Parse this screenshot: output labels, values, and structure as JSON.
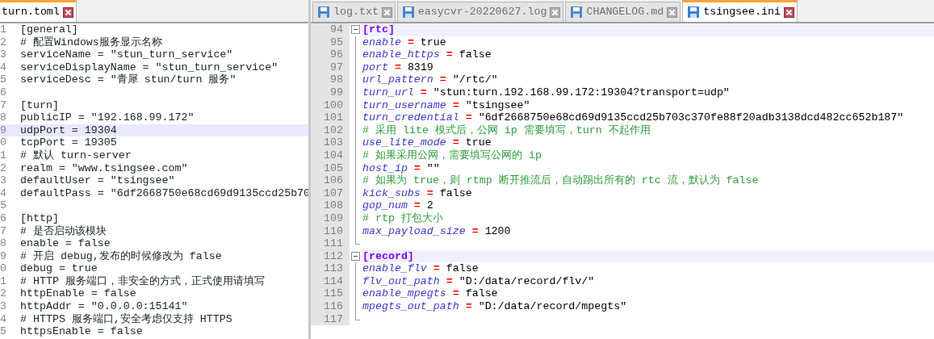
{
  "left_pane": {
    "tabs": [
      {
        "label": "turn.toml",
        "selected": true
      }
    ],
    "lines": [
      {
        "number": "1",
        "text": "[general]",
        "highlighted": false
      },
      {
        "number": "2",
        "text": "# 配置Windows服务显示名称",
        "highlighted": false
      },
      {
        "number": "3",
        "text": "serviceName = \"stun_turn_service\"",
        "highlighted": false
      },
      {
        "number": "4",
        "text": "serviceDisplayName = \"stun_turn_service\"",
        "highlighted": false
      },
      {
        "number": "5",
        "text": "serviceDesc = \"青犀 stun/turn 服务\"",
        "highlighted": false
      },
      {
        "number": "6",
        "highlighted": false
      },
      {
        "number": "7",
        "text": "[turn]",
        "highlighted": false
      },
      {
        "number": "8",
        "text": "publicIP = \"192.168.99.172\"",
        "highlighted": false
      },
      {
        "number": "9",
        "text": "udpPort = 19304",
        "highlighted": true
      },
      {
        "number": "0",
        "text": "tcpPort = 19305",
        "highlighted": false
      },
      {
        "number": "1",
        "text": "# 默认 turn-server",
        "highlighted": false
      },
      {
        "number": "2",
        "text": "realm = \"www.tsingsee.com\"",
        "highlighted": false
      },
      {
        "number": "3",
        "text": "defaultUser = \"tsingsee\"",
        "highlighted": false
      },
      {
        "number": "4",
        "text": "defaultPass = \"6df2668750e68cd69d9135ccd25b70",
        "highlighted": false
      },
      {
        "number": "5",
        "highlighted": false
      },
      {
        "number": "6",
        "text": "[http]",
        "highlighted": false
      },
      {
        "number": "7",
        "text": "# 是否启动该模块",
        "highlighted": false
      },
      {
        "number": "8",
        "text": "enable = false",
        "highlighted": false
      },
      {
        "number": "9",
        "text": "# 开启 debug,发布的时候修改为 false",
        "highlighted": false
      },
      {
        "number": "0",
        "text": "debug = true",
        "highlighted": false
      },
      {
        "number": "1",
        "text": "# HTTP 服务端口，非安全的方式，正式使用请填写",
        "highlighted": false
      },
      {
        "number": "2",
        "text": "httpEnable = false",
        "highlighted": false
      },
      {
        "number": "3",
        "text": "httpAddr = \"0.0.0.0:15141\"",
        "highlighted": false
      },
      {
        "number": "4",
        "text": "# HTTPS 服务端口,安全考虑仅支持 HTTPS",
        "highlighted": false
      },
      {
        "number": "5",
        "text": "httpsEnable = false",
        "highlighted": false
      }
    ]
  },
  "right_pane": {
    "tabs": [
      {
        "label": "log.txt",
        "selected": false
      },
      {
        "label": "easycvr-20220627.log",
        "selected": false
      },
      {
        "label": "CHANGELOG.md",
        "selected": false
      },
      {
        "label": "tsingsee.ini",
        "selected": true
      }
    ],
    "lines": [
      {
        "number": "94",
        "kind": "section",
        "text": "[rtc]",
        "fold_start": true,
        "fold_end": false,
        "highlighted": true
      },
      {
        "number": "95",
        "kind": "setting",
        "key": "enable",
        "op": "=",
        "value": "true",
        "fold_start": false,
        "fold_end": false,
        "highlighted": false
      },
      {
        "number": "96",
        "kind": "setting",
        "key": "enable_https",
        "op": "=",
        "value": "false",
        "fold_start": false,
        "fold_end": false,
        "highlighted": false
      },
      {
        "number": "97",
        "kind": "setting",
        "key": "port",
        "op": "=",
        "value": "8319",
        "fold_start": false,
        "fold_end": false,
        "highlighted": false
      },
      {
        "number": "98",
        "kind": "setting",
        "key": "url_pattern",
        "op": "=",
        "value": "\"/rtc/\"",
        "fold_start": false,
        "fold_end": false,
        "highlighted": false
      },
      {
        "number": "99",
        "kind": "setting",
        "key": "turn_url",
        "op": "=",
        "value": "\"stun:turn.192.168.99.172:19304?transport=udp\"",
        "fold_start": false,
        "fold_end": false,
        "highlighted": false
      },
      {
        "number": "100",
        "kind": "setting",
        "key": "turn_username",
        "op": "=",
        "value": "\"tsingsee\"",
        "fold_start": false,
        "fold_end": false,
        "highlighted": false
      },
      {
        "number": "101",
        "kind": "setting",
        "key": "turn_credential",
        "op": "=",
        "value": "\"6df2668750e68cd69d9135ccd25b703c370fe88f20adb3138dcd482cc652b187\"",
        "fold_start": false,
        "fold_end": false,
        "highlighted": false
      },
      {
        "number": "102",
        "kind": "comment",
        "text": "# 采用 lite 模式后，公网 ip 需要填写，turn 不起作用",
        "fold_start": false,
        "fold_end": false,
        "highlighted": false
      },
      {
        "number": "103",
        "kind": "setting",
        "key": "use_lite_mode",
        "op": "=",
        "value": "true",
        "fold_start": false,
        "fold_end": false,
        "highlighted": false
      },
      {
        "number": "104",
        "kind": "comment",
        "text": "# 如果采用公网，需要填写公网的 ip",
        "fold_start": false,
        "fold_end": false,
        "highlighted": false
      },
      {
        "number": "105",
        "kind": "setting",
        "key": "host_ip",
        "op": "=",
        "value": "\"\"",
        "fold_start": false,
        "fold_end": false,
        "highlighted": false
      },
      {
        "number": "106",
        "kind": "comment",
        "text": "# 如果为 true，则 rtmp 断开推流后，自动踢出所有的 rtc 流，默认为 false",
        "fold_start": false,
        "fold_end": false,
        "highlighted": false
      },
      {
        "number": "107",
        "kind": "setting",
        "key": "kick_subs",
        "op": "=",
        "value": "false",
        "fold_start": false,
        "fold_end": false,
        "highlighted": false
      },
      {
        "number": "108",
        "kind": "setting",
        "key": "gop_num",
        "op": "=",
        "value": "2",
        "fold_start": false,
        "fold_end": false,
        "highlighted": false
      },
      {
        "number": "109",
        "kind": "comment",
        "text": "# rtp 打包大小",
        "fold_start": false,
        "fold_end": false,
        "highlighted": false
      },
      {
        "number": "110",
        "kind": "setting",
        "key": "max_payload_size",
        "op": "=",
        "value": "1200",
        "fold_start": false,
        "fold_end": false,
        "highlighted": false
      },
      {
        "number": "111",
        "kind": "blank",
        "fold_start": false,
        "fold_end": true,
        "highlighted": false
      },
      {
        "number": "112",
        "kind": "section",
        "text": "[record]",
        "fold_start": true,
        "fold_end": false,
        "highlighted": true
      },
      {
        "number": "113",
        "kind": "setting",
        "key": "enable_flv",
        "op": "=",
        "value": "false",
        "fold_start": false,
        "fold_end": false,
        "highlighted": false
      },
      {
        "number": "114",
        "kind": "setting",
        "key": "flv_out_path",
        "op": "=",
        "value": "\"D:/data/record/flv/\"",
        "fold_start": false,
        "fold_end": false,
        "highlighted": false
      },
      {
        "number": "115",
        "kind": "setting",
        "key": "enable_mpegts",
        "op": "=",
        "value": "false",
        "fold_start": false,
        "fold_end": false,
        "highlighted": false
      },
      {
        "number": "116",
        "kind": "setting",
        "key": "mpegts_out_path",
        "op": "=",
        "value": "\"D:/data/record/mpegts\"",
        "fold_start": false,
        "fold_end": false,
        "highlighted": false
      },
      {
        "number": "117",
        "kind": "blank",
        "fold_start": false,
        "fold_end": true,
        "highlighted": false
      }
    ]
  }
}
